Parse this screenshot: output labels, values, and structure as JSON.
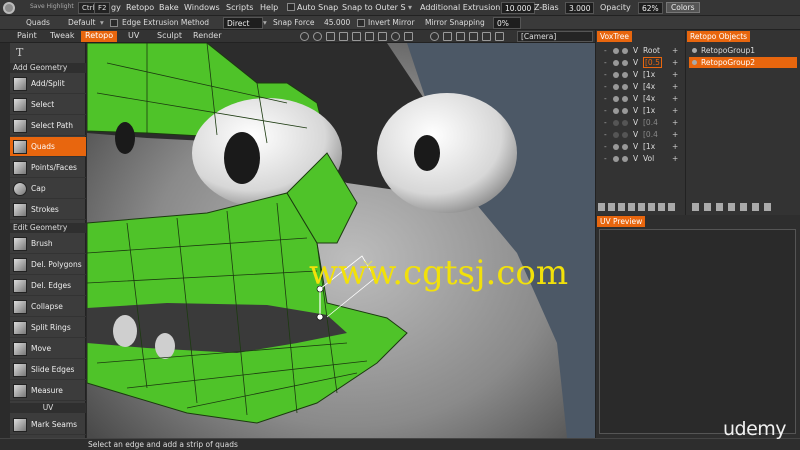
{
  "menubar": {
    "hint": "Save Highlight",
    "key1": "Ctrl",
    "key2": "F2",
    "items": [
      "Retopo",
      "Bake",
      "Windows",
      "Scripts",
      "Help"
    ],
    "partial": "gy"
  },
  "options": {
    "mode": "Quads",
    "default_field": "Default",
    "edge_extrusion_label": "Edge Extrusion Method",
    "edge_extrusion_value": "Direct",
    "snap_force_label": "Snap Force",
    "snap_force_value": "45.000",
    "invert_mirror": "Invert Mirror",
    "mirror_snapping_label": "Mirror Snapping",
    "mirror_snapping_value": "0%",
    "auto_snap": "Auto Snap",
    "snap_to_outer": "Snap to Outer S",
    "additional_extrusion_label": "Additional Extrusion",
    "additional_extrusion_value": "10.000",
    "zbias_label": "Z-Bias",
    "zbias_value": "3.000",
    "opacity_label": "Opacity",
    "opacity_value": "62%",
    "colors_button": "Colors"
  },
  "tabs": [
    "Paint",
    "Tweak",
    "Retopo",
    "UV",
    "Sculpt",
    "Render"
  ],
  "active_tab": "Retopo",
  "camera": "[Camera]",
  "toolpanel": {
    "sections": [
      {
        "title": "Add Geometry",
        "tools": [
          "Add/Split",
          "Select",
          "Select Path",
          "Quads",
          "Points/Faces",
          "Cap",
          "Strokes"
        ]
      },
      {
        "title": "Edit Geometry",
        "tools": [
          "Brush",
          "Del. Polygons",
          "Del. Edges",
          "Collapse",
          "Split Rings",
          "Move",
          "Slide Edges",
          "Measure"
        ]
      },
      {
        "title": "UV",
        "tools": [
          "Mark Seams"
        ]
      }
    ],
    "active_tool": "Quads"
  },
  "voxtree": {
    "title": "VoxTree",
    "rows": [
      {
        "name": "Root"
      },
      {
        "name": "[0.5"
      },
      {
        "name": "[1x"
      },
      {
        "name": "[4x"
      },
      {
        "name": "[4x"
      },
      {
        "name": "[1x"
      },
      {
        "name": "[0.4"
      },
      {
        "name": "[0.4"
      },
      {
        "name": "[1x"
      },
      {
        "name": "Vol"
      }
    ]
  },
  "retopo_objects": {
    "title": "Retopo Objects",
    "items": [
      "RetopoGroup1",
      "RetopoGroup2"
    ],
    "active": "RetopoGroup2"
  },
  "uv_preview": {
    "title": "UV Preview"
  },
  "status": {
    "message": "Select an edge and add a strip of quads"
  },
  "watermark": "www.cgtsj.com",
  "brand": "udemy",
  "colors": {
    "accent": "#e8660e",
    "mesh_green": "#4fc329",
    "watermark": "#f2e10a"
  }
}
